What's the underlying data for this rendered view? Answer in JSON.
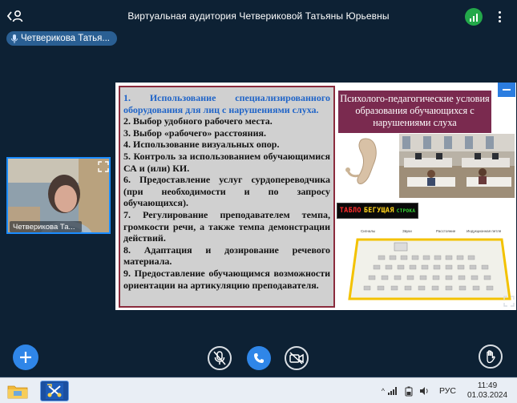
{
  "header": {
    "title": "Виртуальная аудитория Четвериковой Татьяны Юрьевны"
  },
  "speaker_chip": {
    "label": "Четверикова Татья..."
  },
  "slide": {
    "items": [
      "1. Использование специализированного оборудования для лиц с нарушениями слуха.",
      "2. Выбор удобного рабочего места.",
      "3. Выбор «рабочего» расстояния.",
      "4. Использование визуальных опор.",
      "5. Контроль за использованием обучающимися СА и (или) КИ.",
      "6. Предоставление услуг сурдопереводчика (при необходимости и по запросу обучающихся).",
      "7. Регулирование преподавателем темпа, громкости речи, а также темпа демонстрации действий.",
      "8. Адаптация и дозирование речевого материала.",
      "9. Предоставление обучающимся возможности ориентации на артикуляцию преподавателя."
    ],
    "heading": "Психолого-педагогические условия образования обучающихся с нарушениями слуха",
    "led_board": {
      "word1": "ТАБЛО",
      "word2": "БЕГУЩАЯ",
      "word3": "СТРОКА"
    },
    "plan_labels": [
      "Сигналы",
      "Звуки",
      "Расстояние",
      "Индукционная петля"
    ]
  },
  "video_tile": {
    "name": "Четверикова Та..."
  },
  "taskbar": {
    "language": "РУС",
    "time": "11:49",
    "date": "01.03.2024"
  },
  "icons": {
    "back": "person-back-icon",
    "signal": "signal-bars-icon",
    "menu": "more-vertical-icon",
    "add": "plus-icon",
    "mic_off": "mic-off-icon",
    "call": "phone-icon",
    "cam_off": "camera-off-icon",
    "hand": "raise-hand-icon"
  },
  "colors": {
    "background": "#0d2134",
    "accent": "#2f86e8",
    "signal": "#23a84a",
    "slide_heading": "#7a2a4f",
    "slide_border": "#8a2b3c",
    "first_item": "#1f64c8"
  }
}
